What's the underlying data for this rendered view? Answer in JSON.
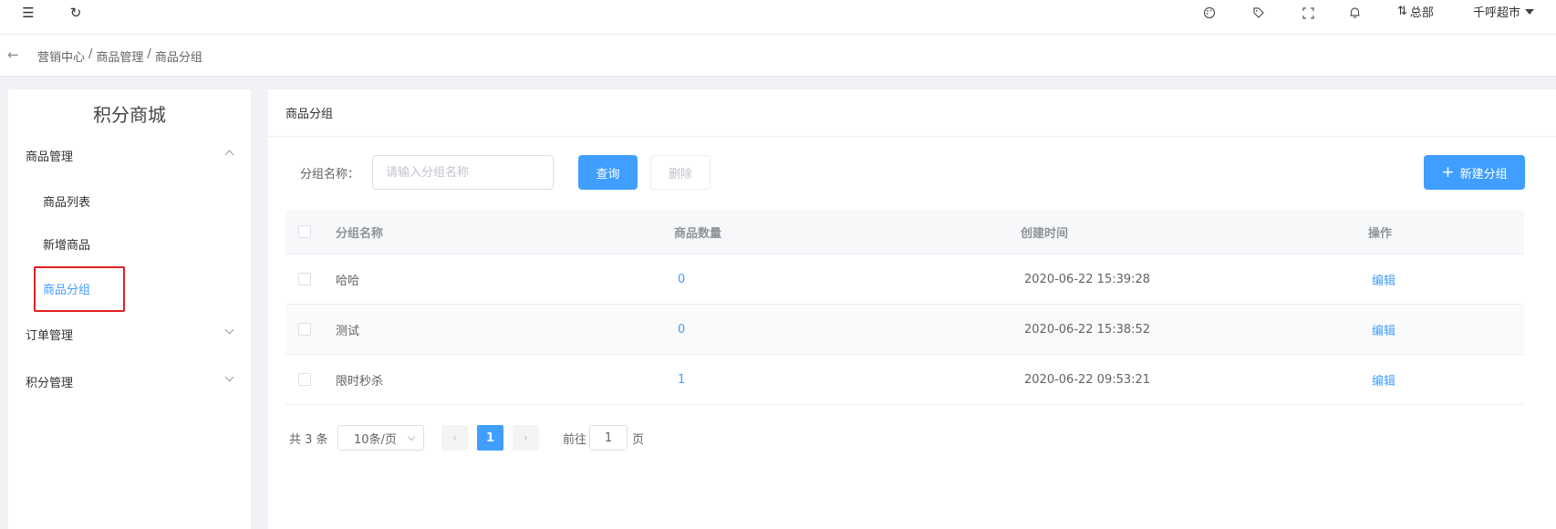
{
  "topbar": {
    "menu_icon": "☰",
    "refresh_icon": "↻",
    "palette_icon": "🎨",
    "tag_icon": "🏷",
    "fullscreen_icon": "⤢",
    "bell_icon": "🔔",
    "switch_icon": "⇅",
    "hq_label": "总部",
    "store_label": "千呼超市"
  },
  "breadcrumb": {
    "back_icon": "←",
    "items": [
      "营销中心",
      "商品管理",
      "商品分组"
    ],
    "separator": "/"
  },
  "sidebar": {
    "title": "积分商城",
    "groups": [
      {
        "label": "商品管理",
        "expanded": true,
        "items": [
          "商品列表",
          "新增商品",
          "商品分组"
        ]
      },
      {
        "label": "订单管理",
        "expanded": false
      },
      {
        "label": "积分管理",
        "expanded": false
      }
    ],
    "active_item": "商品分组"
  },
  "main": {
    "title": "商品分组",
    "filter": {
      "label": "分组名称：",
      "placeholder": "请输入分组名称",
      "value": ""
    },
    "buttons": {
      "query": "查询",
      "delete": "删除",
      "new_plus": "+",
      "new": "新建分组"
    },
    "table": {
      "headers": [
        "分组名称",
        "商品数量",
        "创建时间",
        "操作"
      ],
      "rows": [
        {
          "name": "哈哈",
          "count": "0",
          "created": "2020-06-22 15:39:28",
          "action": "编辑"
        },
        {
          "name": "测试",
          "count": "0",
          "created": "2020-06-22 15:38:52",
          "action": "编辑"
        },
        {
          "name": "限时秒杀",
          "count": "1",
          "created": "2020-06-22 09:53:21",
          "action": "编辑"
        }
      ]
    },
    "pagination": {
      "total": "共 3 条",
      "page_size": "10条/页",
      "prev": "‹",
      "current": "1",
      "next": "›",
      "goto_label": "前往",
      "goto_value": "1",
      "page_suffix": "页"
    }
  },
  "colors": {
    "primary": "#409eff",
    "highlight": "#e02020"
  }
}
